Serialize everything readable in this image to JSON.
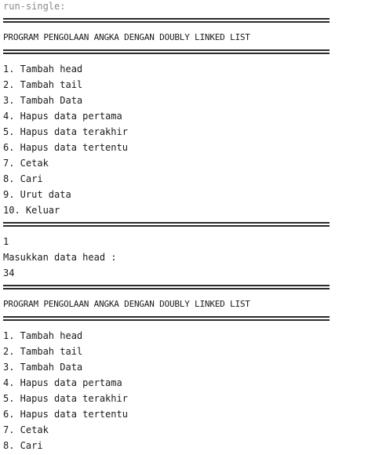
{
  "console": {
    "header": "run-single:",
    "title": "PROGRAM PENGOLAAN ANGKA DENGAN DOUBLY LINKED LIST",
    "menu_first": [
      "1. Tambah head",
      "2. Tambah tail",
      "3. Tambah Data",
      "4. Hapus data pertama",
      "5. Hapus data terakhir",
      "6. Hapus data tertentu",
      "7. Cetak",
      "8. Cari",
      "9. Urut data",
      "10. Keluar"
    ],
    "input_choice": "1",
    "prompt": "Masukkan data head :",
    "input_value": "34",
    "menu_second": [
      "1. Tambah head",
      "2. Tambah tail",
      "3. Tambah Data",
      "4. Hapus data pertama",
      "5. Hapus data terakhir",
      "6. Hapus data tertentu",
      "7. Cetak",
      "8. Cari"
    ]
  }
}
